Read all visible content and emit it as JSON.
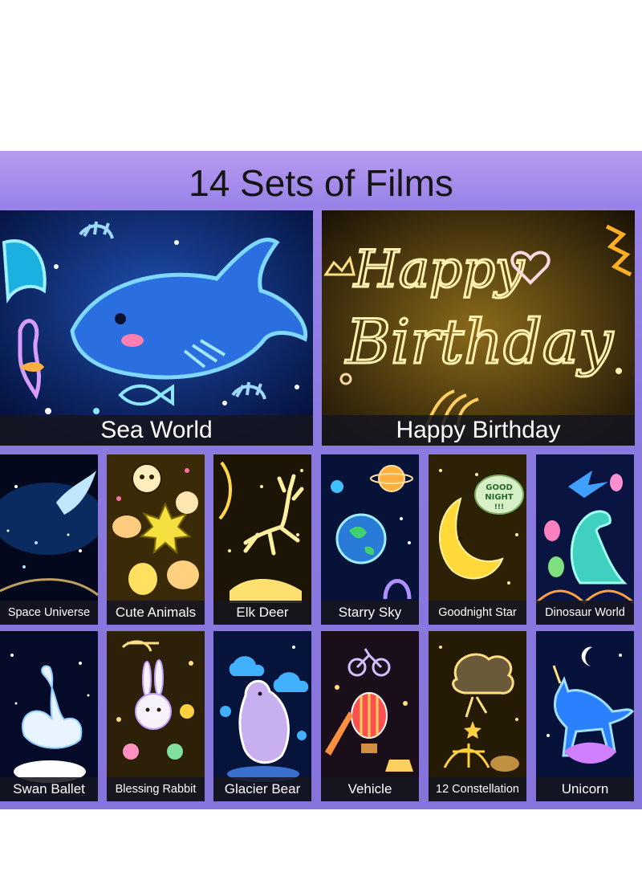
{
  "heading": "14 Sets of Films",
  "colors": {
    "banner": "#8b7ae0",
    "caption_bg": "#16161f",
    "caption_text": "#ffffff"
  },
  "films": {
    "sea_world": "Sea World",
    "happy_birthday": "Happy Birthday",
    "space_universe": "Space Universe",
    "cute_animals": "Cute Animals",
    "elk_deer": "Elk Deer",
    "starry_sky": "Starry Sky",
    "goodnight_star": "Goodnight Star",
    "dinosaur_world": "Dinosaur World",
    "swan_ballet": "Swan Ballet",
    "blessing_rabbit": "Blessing Rabbit",
    "glacier_bear": "Glacier Bear",
    "vehicle": "Vehicle",
    "constellation": "12 Constellation",
    "unicorn": "Unicorn"
  },
  "artwork_text": {
    "birthday_line1": "Happy",
    "birthday_line2": "Birthday",
    "goodnight_bubble_line1": "GOOD",
    "goodnight_bubble_line2": "NIGHT",
    "goodnight_bubble_line3": "!!!"
  }
}
